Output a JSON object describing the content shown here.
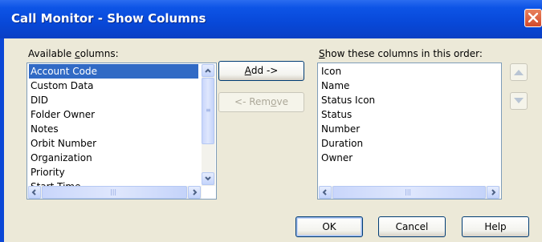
{
  "window": {
    "title": "Call Monitor - Show Columns"
  },
  "available": {
    "label_pre": "Available ",
    "label_key": "c",
    "label_post": "olumns:",
    "items": [
      "Account Code",
      "Custom Data",
      "DID",
      "Folder Owner",
      "Notes",
      "Orbit Number",
      "Organization",
      "Priority",
      "Start Time"
    ],
    "selected": "Account Code"
  },
  "shown": {
    "label_key": "S",
    "label_post": "how these columns in this order:",
    "items": [
      "Icon",
      "Name",
      "Status Icon",
      "Status",
      "Number",
      "Duration",
      "Owner"
    ]
  },
  "buttons": {
    "add_key": "A",
    "add_post": "dd ->",
    "remove_pre": "<- Rem",
    "remove_key": "o",
    "remove_post": "ve",
    "ok": "OK",
    "cancel": "Cancel",
    "help": "Help"
  },
  "icons": {
    "close": "close-icon",
    "move_up": "triangle-up-icon",
    "move_down": "triangle-down-icon"
  }
}
